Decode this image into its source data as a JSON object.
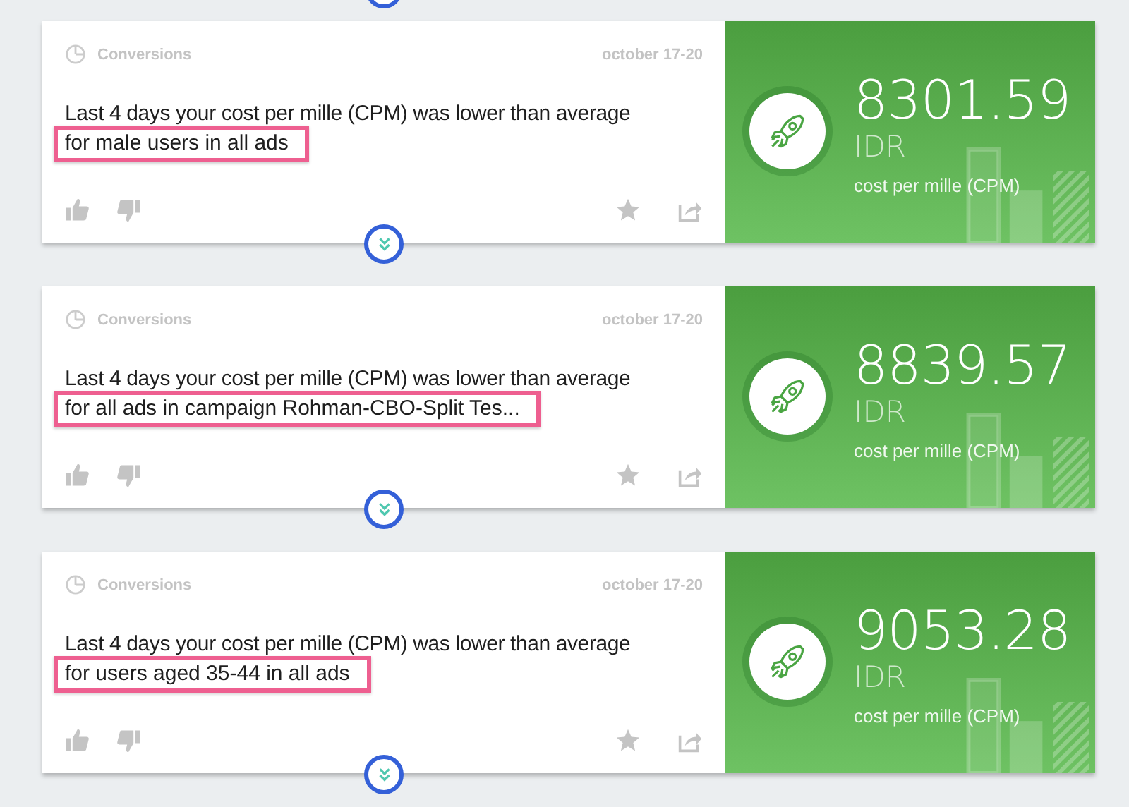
{
  "cards": [
    {
      "category": "Conversions",
      "date": "october 17-20",
      "message": "Last 4 days your cost per mille (CPM) was lower than average",
      "highlight": "for male users in all ads",
      "value": "8301.59",
      "currency": "IDR",
      "metric": "cost per mille (CPM)"
    },
    {
      "category": "Conversions",
      "date": "october 17-20",
      "message": "Last 4 days your cost per mille (CPM) was lower than average",
      "highlight": "for all ads in campaign Rohman-CBO-Split Tes...",
      "value": "8839.57",
      "currency": "IDR",
      "metric": "cost per mille (CPM)"
    },
    {
      "category": "Conversions",
      "date": "october 17-20",
      "message": "Last 4 days your cost per mille (CPM) was lower than average",
      "highlight": "for users aged 35-44 in all ads",
      "value": "9053.28",
      "currency": "IDR",
      "metric": "cost per mille (CPM)"
    }
  ]
}
